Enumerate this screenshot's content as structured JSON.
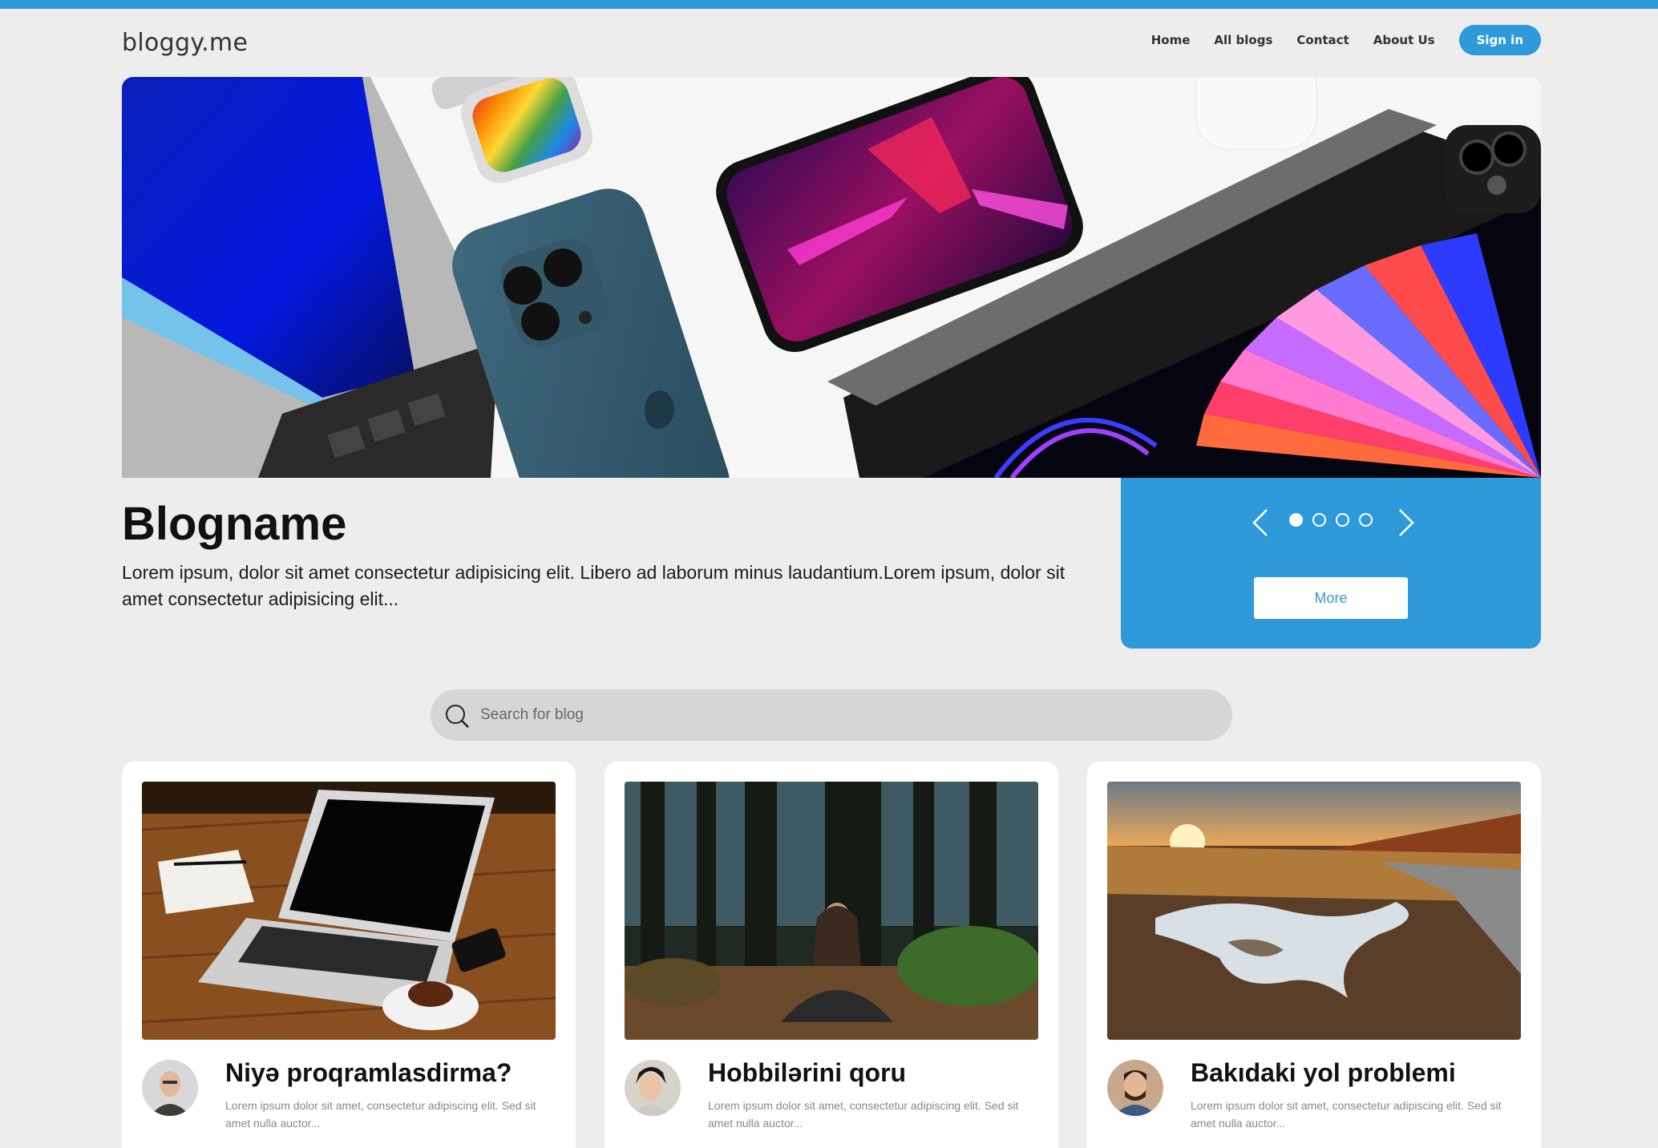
{
  "header": {
    "logo": "bloggy.me",
    "nav": [
      "Home",
      "All blogs",
      "Contact",
      "About Us"
    ],
    "sign_in": "Sign in"
  },
  "hero": {
    "title": "Blogname",
    "description": "Lorem ipsum, dolor sit amet consectetur adipisicing elit. Libero ad laborum minus laudantium.Lorem ipsum, dolor sit amet consectetur adipisicing elit...",
    "more_label": "More",
    "slide_count": 4,
    "active_slide": 1
  },
  "search": {
    "placeholder": "Search for blog"
  },
  "cards": [
    {
      "title": "Niyə proqramlasdirma?",
      "description": "Lorem ipsum dolor sit amet, consectetur adipiscing elit. Sed sit amet nulla auctor..."
    },
    {
      "title": "Hobbilərini qoru",
      "description": "Lorem ipsum dolor sit amet, consectetur adipiscing elit. Sed sit amet nulla auctor..."
    },
    {
      "title": "Bakıdaki yol problemi",
      "description": "Lorem ipsum dolor sit amet, consectetur adipiscing elit. Sed sit amet nulla auctor..."
    }
  ],
  "colors": {
    "accent": "#2f9ad9",
    "background": "#ededed"
  }
}
